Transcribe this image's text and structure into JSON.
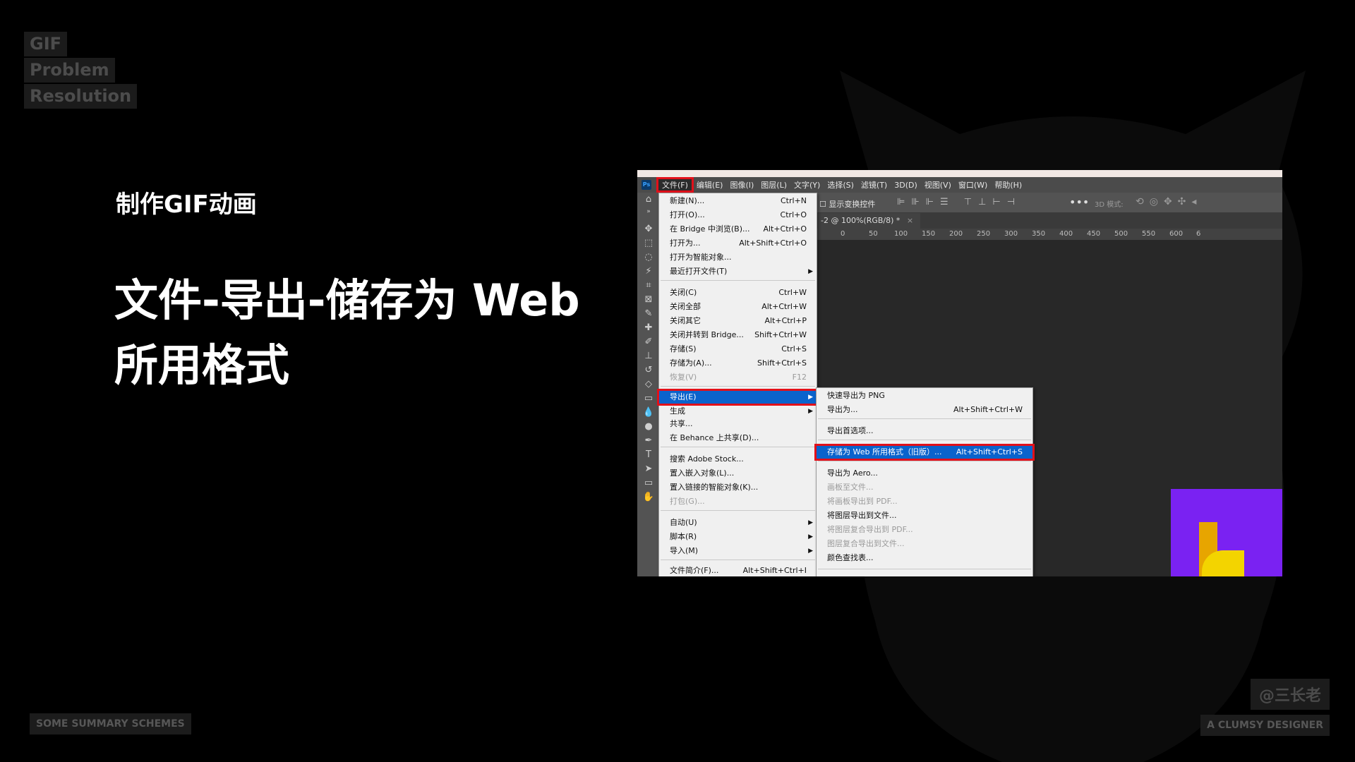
{
  "tags": [
    "GIF",
    "Problem",
    "Resolution"
  ],
  "subtitle": "制作GIF动画",
  "headline": "文件-导出-储存为 Web 所用格式",
  "footer_left": "SOME SUMMARY SCHEMES",
  "footer_right": "A CLUMSY DESIGNER",
  "watermark": "@三长老",
  "colors": {
    "highlight_border": "#e2101a",
    "menu_highlight": "#0a63cc",
    "purple_canvas": "#7a22f2",
    "yellow_canvas": "#f3d400"
  },
  "photoshop": {
    "logo": "Ps",
    "menubar": [
      "文件(F)",
      "编辑(E)",
      "图像(I)",
      "图层(L)",
      "文字(Y)",
      "选择(S)",
      "滤镜(T)",
      "3D(D)",
      "视图(V)",
      "窗口(W)",
      "帮助(H)"
    ],
    "options_checkbox_label": "显示变换控件",
    "options_more": "•••",
    "options_3d_label": "3D 模式:",
    "tab_title": "-2 @ 100%(RGB/8) *",
    "tab_close": "×",
    "ruler_ticks": [
      "0",
      "50",
      "100",
      "150",
      "200",
      "250",
      "300",
      "350",
      "400",
      "450",
      "500",
      "550",
      "600",
      "6"
    ],
    "file_menu": [
      {
        "label": "新建(N)...",
        "shortcut": "Ctrl+N"
      },
      {
        "label": "打开(O)...",
        "shortcut": "Ctrl+O"
      },
      {
        "label": "在 Bridge 中浏览(B)...",
        "shortcut": "Alt+Ctrl+O"
      },
      {
        "label": "打开为...",
        "shortcut": "Alt+Shift+Ctrl+O"
      },
      {
        "label": "打开为智能对象...",
        "shortcut": ""
      },
      {
        "label": "最近打开文件(T)",
        "shortcut": "",
        "submenu": true
      },
      {
        "label": "关闭(C)",
        "shortcut": "Ctrl+W"
      },
      {
        "label": "关闭全部",
        "shortcut": "Alt+Ctrl+W"
      },
      {
        "label": "关闭其它",
        "shortcut": "Alt+Ctrl+P"
      },
      {
        "label": "关闭并转到 Bridge...",
        "shortcut": "Shift+Ctrl+W"
      },
      {
        "label": "存储(S)",
        "shortcut": "Ctrl+S"
      },
      {
        "label": "存储为(A)...",
        "shortcut": "Shift+Ctrl+S"
      },
      {
        "label": "恢复(V)",
        "shortcut": "F12",
        "disabled": true
      },
      {
        "label": "导出(E)",
        "shortcut": "",
        "submenu": true,
        "highlighted": true
      },
      {
        "label": "生成",
        "shortcut": "",
        "submenu": true
      },
      {
        "label": "共享...",
        "shortcut": ""
      },
      {
        "label": "在 Behance 上共享(D)...",
        "shortcut": ""
      },
      {
        "label": "搜索 Adobe Stock...",
        "shortcut": ""
      },
      {
        "label": "置入嵌入对象(L)...",
        "shortcut": ""
      },
      {
        "label": "置入链接的智能对象(K)...",
        "shortcut": ""
      },
      {
        "label": "打包(G)...",
        "shortcut": "",
        "disabled": true
      },
      {
        "label": "自动(U)",
        "shortcut": "",
        "submenu": true
      },
      {
        "label": "脚本(R)",
        "shortcut": "",
        "submenu": true
      },
      {
        "label": "导入(M)",
        "shortcut": "",
        "submenu": true
      },
      {
        "label": "文件简介(F)...",
        "shortcut": "Alt+Shift+Ctrl+I"
      }
    ],
    "export_menu": [
      {
        "label": "快速导出为 PNG",
        "shortcut": ""
      },
      {
        "label": "导出为...",
        "shortcut": "Alt+Shift+Ctrl+W"
      },
      {
        "label": "导出首选项...",
        "shortcut": ""
      },
      {
        "label": "存储为 Web 所用格式（旧版）...",
        "shortcut": "Alt+Shift+Ctrl+S",
        "highlighted": true
      },
      {
        "label": "导出为 Aero...",
        "shortcut": ""
      },
      {
        "label": "画板至文件...",
        "shortcut": "",
        "disabled": true
      },
      {
        "label": "将画板导出到 PDF...",
        "shortcut": "",
        "disabled": true
      },
      {
        "label": "将图层导出到文件...",
        "shortcut": ""
      },
      {
        "label": "将图层复合导出到 PDF...",
        "shortcut": "",
        "disabled": true
      },
      {
        "label": "图层复合导出到文件...",
        "shortcut": "",
        "disabled": true
      },
      {
        "label": "颜色查找表...",
        "shortcut": ""
      }
    ]
  }
}
